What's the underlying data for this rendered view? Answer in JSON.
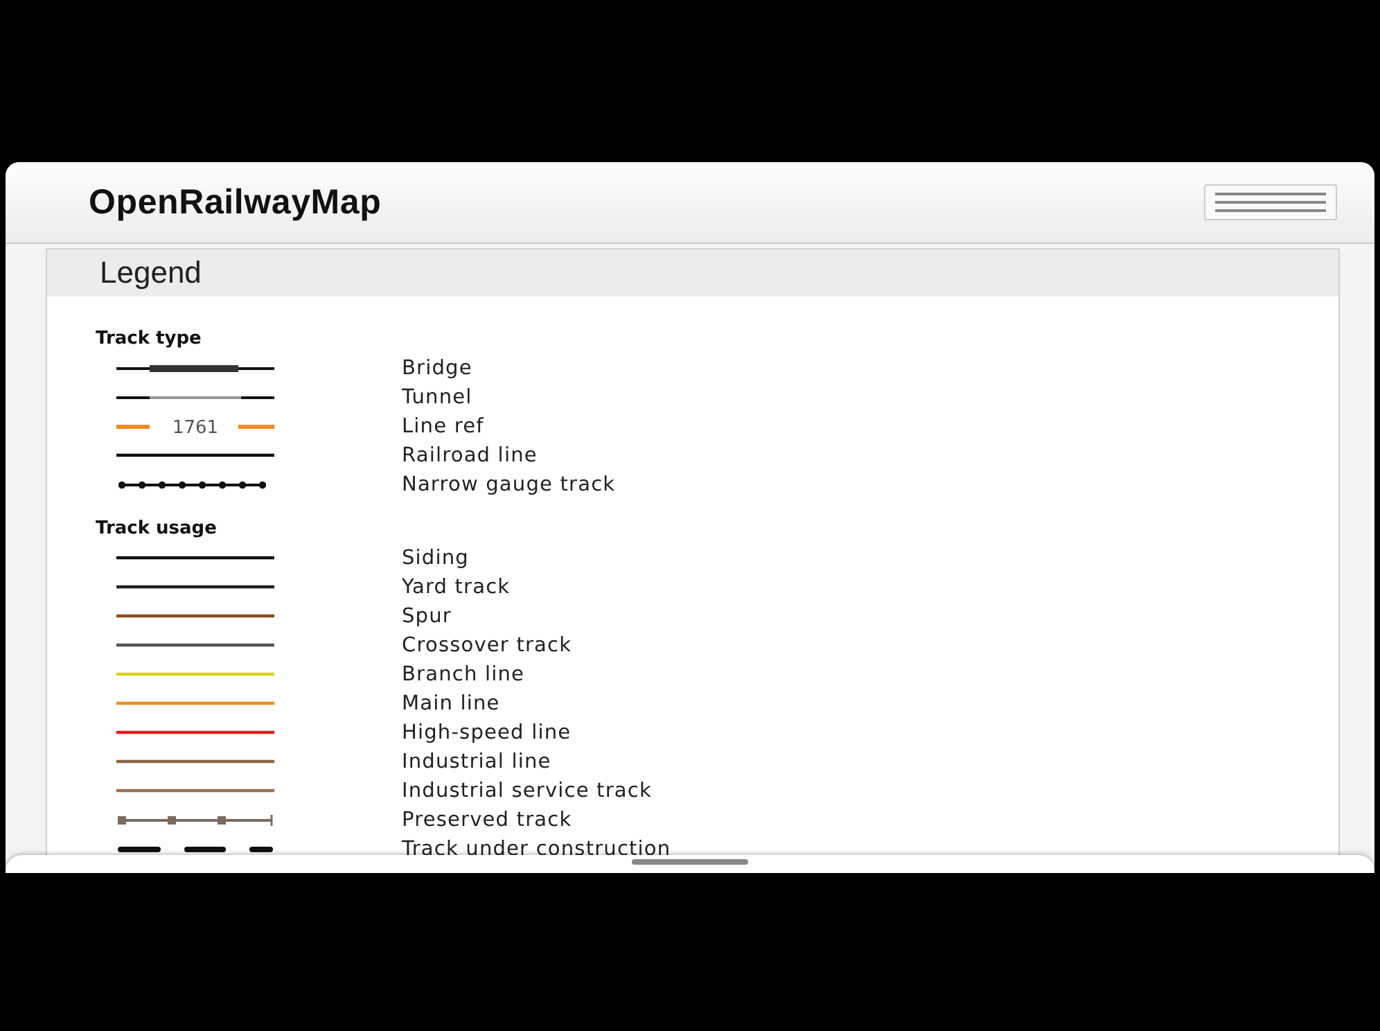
{
  "app": {
    "title": "OpenRailwayMap"
  },
  "legend": {
    "title": "Legend",
    "sections": [
      {
        "heading": "Track type",
        "items": [
          {
            "kind": "bridge",
            "label": "Bridge"
          },
          {
            "kind": "tunnel",
            "label": "Tunnel"
          },
          {
            "kind": "ref",
            "ref": "1761",
            "color": "#f28a1c",
            "label": "Line ref"
          },
          {
            "kind": "line",
            "color": "#111111",
            "label": "Railroad line"
          },
          {
            "kind": "dots",
            "label": "Narrow gauge track"
          }
        ]
      },
      {
        "heading": "Track usage",
        "items": [
          {
            "kind": "line",
            "color": "#111111",
            "label": "Siding"
          },
          {
            "kind": "line",
            "color": "#222222",
            "label": "Yard track"
          },
          {
            "kind": "line",
            "color": "#8a4e1e",
            "label": "Spur"
          },
          {
            "kind": "line",
            "color": "#555555",
            "label": "Crossover track"
          },
          {
            "kind": "line",
            "color": "#d8d020",
            "label": "Branch line"
          },
          {
            "kind": "line",
            "color": "#f28a1c",
            "label": "Main line"
          },
          {
            "kind": "line",
            "color": "#e8191c",
            "label": "High-speed line"
          },
          {
            "kind": "line",
            "color": "#8b6440",
            "label": "Industrial line"
          },
          {
            "kind": "line",
            "color": "#9a7050",
            "label": "Industrial service track"
          },
          {
            "kind": "preserved",
            "label": "Preserved track"
          },
          {
            "kind": "dashed",
            "label": "Track under construction"
          }
        ]
      }
    ]
  }
}
